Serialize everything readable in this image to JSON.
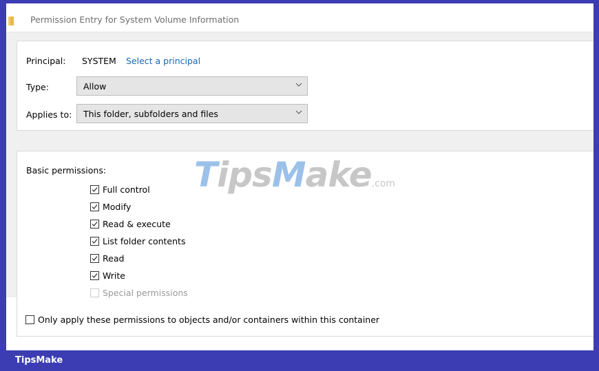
{
  "window": {
    "title": "Permission Entry for System Volume Information",
    "icon": "folder-icon"
  },
  "principal": {
    "label": "Principal:",
    "name": "SYSTEM",
    "select_link": "Select a principal"
  },
  "type": {
    "label": "Type:",
    "value": "Allow"
  },
  "applies_to": {
    "label": "Applies to:",
    "value": "This folder, subfolders and files"
  },
  "permissions": {
    "heading": "Basic permissions:",
    "items": [
      {
        "label": "Full control",
        "checked": true,
        "enabled": true
      },
      {
        "label": "Modify",
        "checked": true,
        "enabled": true
      },
      {
        "label": "Read & execute",
        "checked": true,
        "enabled": true
      },
      {
        "label": "List folder contents",
        "checked": true,
        "enabled": true
      },
      {
        "label": "Read",
        "checked": true,
        "enabled": true
      },
      {
        "label": "Write",
        "checked": true,
        "enabled": true
      },
      {
        "label": "Special permissions",
        "checked": false,
        "enabled": false
      }
    ]
  },
  "only_apply": {
    "label": "Only apply these permissions to objects and/or containers within this container",
    "checked": false
  },
  "watermark": {
    "main": "TipsMake",
    "suffix": ".com"
  },
  "footer": {
    "brand": "TipsMake"
  },
  "colors": {
    "accent_frame": "#3c3db3",
    "link": "#1166bb"
  }
}
